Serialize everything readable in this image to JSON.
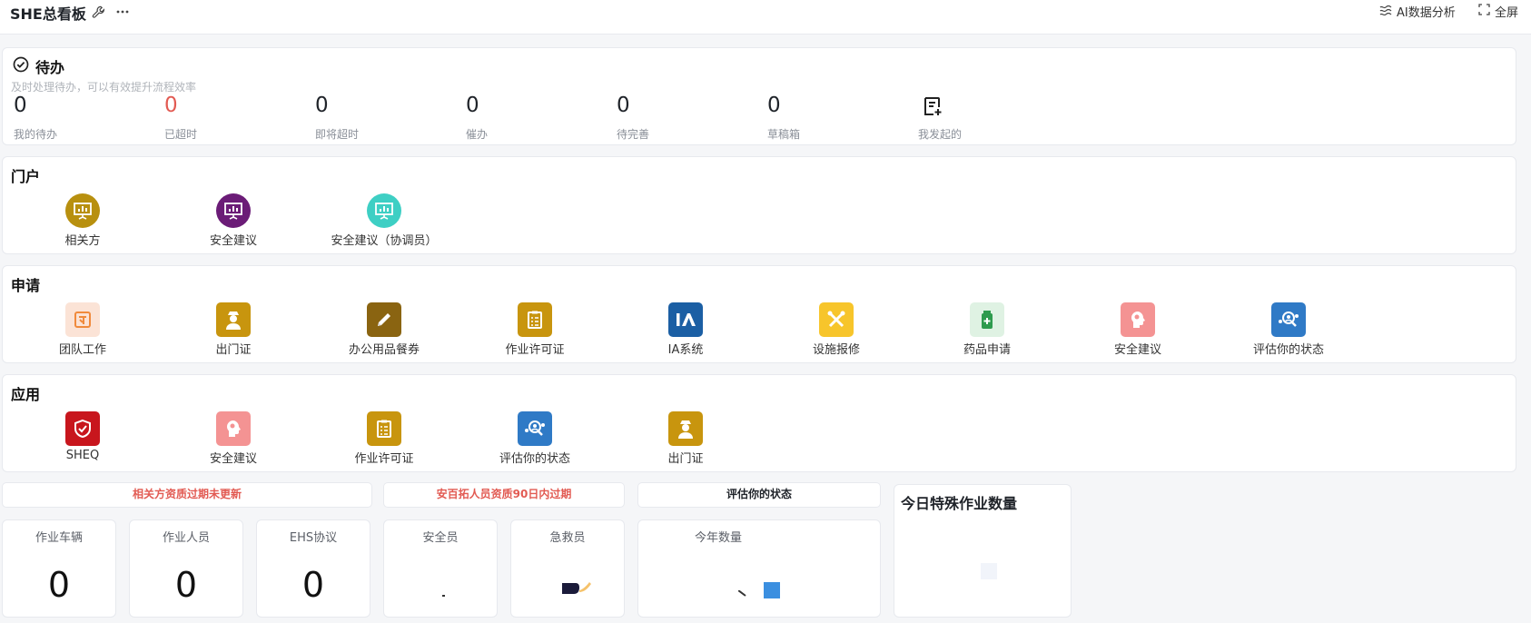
{
  "header": {
    "title": "SHE总看板",
    "ai_label": "AI数据分析",
    "fullscreen_label": "全屏"
  },
  "todo": {
    "title": "待办",
    "subtitle": "及时处理待办，可以有效提升流程效率",
    "items": [
      {
        "value": "0",
        "label": "我的待办"
      },
      {
        "value": "0",
        "label": "已超时"
      },
      {
        "value": "0",
        "label": "即将超时"
      },
      {
        "value": "0",
        "label": "催办"
      },
      {
        "value": "0",
        "label": "待完善"
      },
      {
        "value": "0",
        "label": "草稿箱"
      }
    ],
    "initiated_label": "我发起的"
  },
  "portal": {
    "title": "门户",
    "items": [
      {
        "label": "相关方",
        "icon": "presentation-chart-icon",
        "color": "#b8900f"
      },
      {
        "label": "安全建议",
        "icon": "presentation-chart-icon",
        "color": "#6b1c77"
      },
      {
        "label": "安全建议（协调员）",
        "icon": "presentation-chart-icon",
        "color": "#3ecfc4"
      }
    ]
  },
  "apply": {
    "title": "申请",
    "items": [
      {
        "label": "团队工作",
        "icon": "team-icon",
        "color": "#fbe3d6"
      },
      {
        "label": "出门证",
        "icon": "guard-icon",
        "color": "#c8950e"
      },
      {
        "label": "办公用品餐券",
        "icon": "pencil-icon",
        "color": "#8a6411"
      },
      {
        "label": "作业许可证",
        "icon": "clipboard-icon",
        "color": "#c8950e"
      },
      {
        "label": "IA系统",
        "icon": "ia-icon",
        "color": "#1b5fa4"
      },
      {
        "label": "设施报修",
        "icon": "tools-icon",
        "color": "#f7c52b"
      },
      {
        "label": "药品申请",
        "icon": "medicine-icon",
        "color": "#dff2e3"
      },
      {
        "label": "安全建议",
        "icon": "brain-gear-icon",
        "color": "#f49393"
      },
      {
        "label": "评估你的状态",
        "icon": "people-search-icon",
        "color": "#2f7ac6"
      }
    ]
  },
  "apps": {
    "title": "应用",
    "items": [
      {
        "label": "SHEQ",
        "icon": "shield-check-icon",
        "color": "#c8161d"
      },
      {
        "label": "安全建议",
        "icon": "brain-gear-icon",
        "color": "#f49393"
      },
      {
        "label": "作业许可证",
        "icon": "clipboard-icon",
        "color": "#c8950e"
      },
      {
        "label": "评估你的状态",
        "icon": "people-search-icon",
        "color": "#2f7ac6"
      },
      {
        "label": "出门证",
        "icon": "guard-icon",
        "color": "#c8950e"
      }
    ]
  },
  "banners": {
    "expired": "相关方资质过期未更新",
    "expiring": "安百拓人员资质90日内过期",
    "assess": "评估你的状态"
  },
  "stats": [
    {
      "label": "作业车辆",
      "value": "0"
    },
    {
      "label": "作业人员",
      "value": "0"
    },
    {
      "label": "EHS协议",
      "value": "0"
    },
    {
      "label": "安全员",
      "value": ""
    },
    {
      "label": "急救员",
      "value": ""
    }
  ],
  "year_count": {
    "label": "今年数量"
  },
  "special_work": {
    "title": "今日特殊作业数量"
  }
}
